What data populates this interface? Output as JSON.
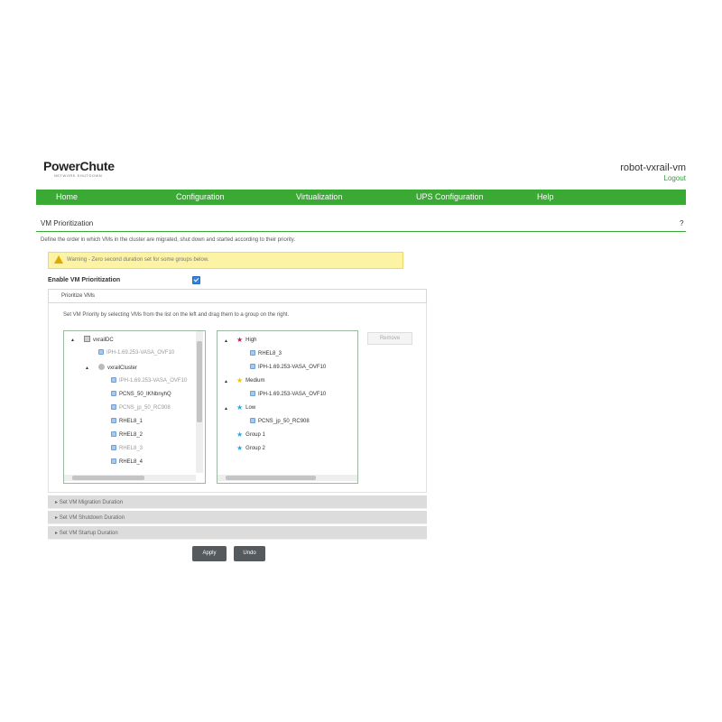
{
  "header": {
    "logo": "PowerChute",
    "logo_sub": "NETWORK SHUTDOWN",
    "hostname": "robot-vxrail-vm",
    "logout": "Logout"
  },
  "nav": [
    "Home",
    "Configuration",
    "Virtualization",
    "UPS Configuration",
    "Help"
  ],
  "page": {
    "title": "VM Prioritization",
    "help": "?",
    "description": "Define the order in which VMs in the cluster are migrated, shut down and started according to their priority."
  },
  "warning": {
    "text": "Warning - Zero second duration set for some groups below."
  },
  "enable": {
    "label": "Enable VM Prioritization",
    "checked": true
  },
  "panel": {
    "title": "Prioritize VMs",
    "instructions": "Set VM Priority by selecting VMs from the list on the left and drag them to a group on the right."
  },
  "left_tree": [
    {
      "label": "vxrailDC",
      "type": "datacenter"
    },
    {
      "label": "IPH-1.69.253-VASA_OVF10",
      "type": "vm",
      "gray": true
    },
    {
      "label": "vxrailCluster",
      "type": "cluster"
    },
    {
      "label": "IPH-1.69.253-VASA_OVF10",
      "type": "vm",
      "gray": true
    },
    {
      "label": "PCNS_50_IKNbnyhQ",
      "type": "vm"
    },
    {
      "label": "PCNS_jp_50_RC908",
      "type": "vm",
      "gray": true
    },
    {
      "label": "RHEL8_1",
      "type": "vm"
    },
    {
      "label": "RHEL8_2",
      "type": "vm"
    },
    {
      "label": "RHEL8_3",
      "type": "vm",
      "gray": true
    },
    {
      "label": "RHEL8_4",
      "type": "vm"
    }
  ],
  "right_tree": [
    {
      "label": "High",
      "type": "group"
    },
    {
      "label": "RHEL8_3",
      "type": "vm"
    },
    {
      "label": "IPH-1.69.253-VASA_OVF10",
      "type": "vm"
    },
    {
      "label": "Medium",
      "type": "group"
    },
    {
      "label": "IPH-1.69.253-VASA_OVF10",
      "type": "vm"
    },
    {
      "label": "Low",
      "type": "group"
    },
    {
      "label": "PCNS_jp_50_RC908",
      "type": "vm"
    },
    {
      "label": "Group 1",
      "type": "group"
    },
    {
      "label": "Group 2",
      "type": "group"
    }
  ],
  "remove_button": "Remove",
  "sections": [
    "Set VM Migration Duration",
    "Set VM Shutdown Duration",
    "Set VM Startup Duration"
  ],
  "buttons": {
    "apply": "Apply",
    "undo": "Undo"
  },
  "colors": {
    "brand_green": "#3aaa35",
    "warning_bg": "#fcf3a4",
    "star_high": "#c2185b",
    "star_medium": "#f2c200",
    "star_low": "#29a8e0",
    "star_group": "#29a8e0"
  },
  "icons": {
    "warning": "warning-triangle-icon",
    "checkbox": "checkbox-checked-icon",
    "datacenter": "datacenter-icon",
    "cluster": "cluster-icon",
    "vm": "vm-icon",
    "group": "star-icon"
  }
}
